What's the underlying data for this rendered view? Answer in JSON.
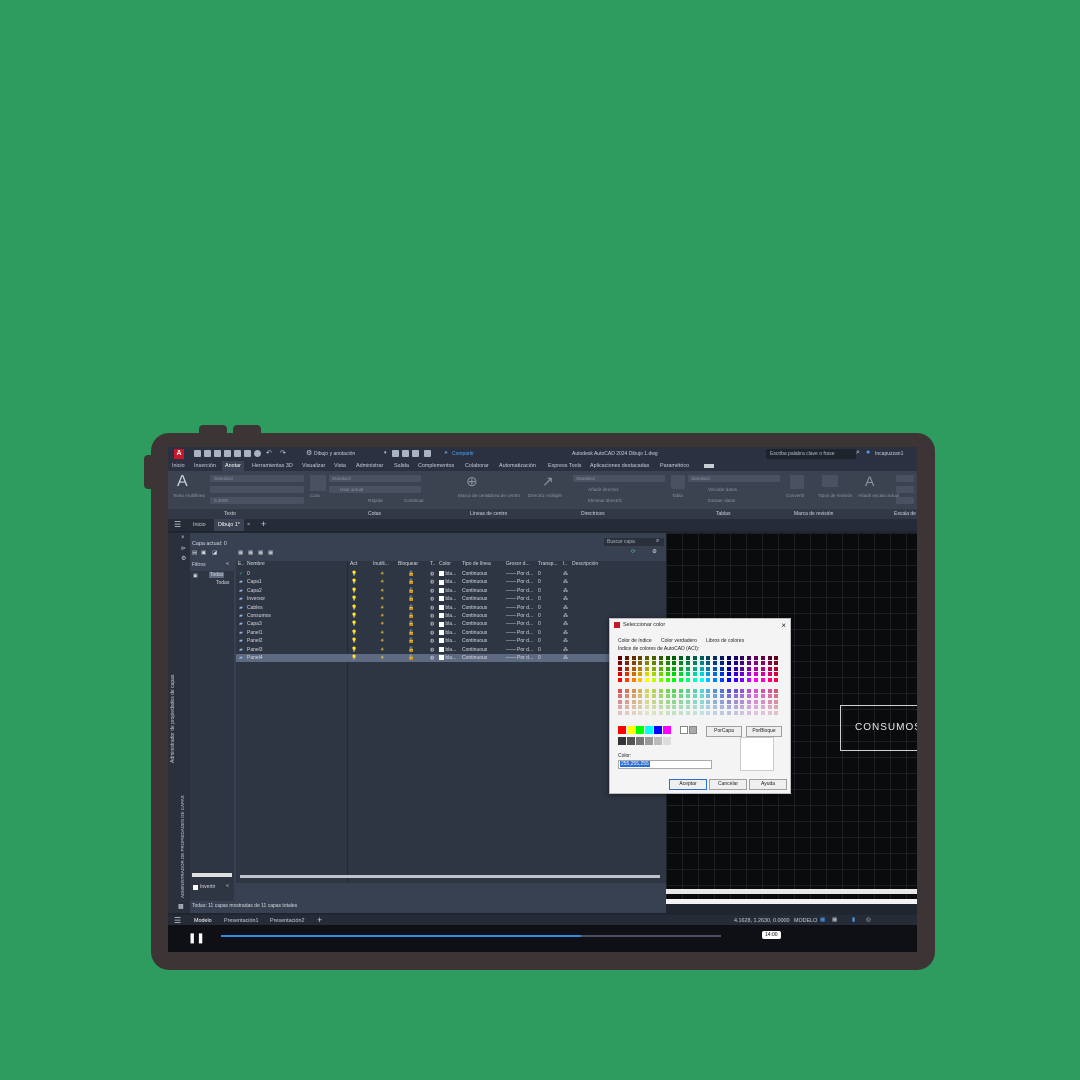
{
  "titlebar": {
    "logo": "A",
    "workspace": "Dibujo y anotación",
    "share": "Compartir",
    "app_title": "Autodesk AutoCAD 2024   Dibujo 1.dwg",
    "search_placeholder": "Escriba palabra clave o frase",
    "user": "Incapuzzan1"
  },
  "menu": [
    "Inicio",
    "Inserción",
    "Anotar",
    "Herramientas 3D",
    "Visualizar",
    "Vista",
    "Administrar",
    "Salida",
    "Complementos",
    "Colaborar",
    "Automatización",
    "Express Tools",
    "Aplicaciones destacadas",
    "Paramétrico"
  ],
  "menu_active_index": 2,
  "ribbon": {
    "panels": [
      "Texto",
      "Cotas",
      "Líneas de centro",
      "Directrices",
      "Tablas",
      "Marca de revisión",
      "Escala de"
    ],
    "text_style": "Standard",
    "text_height": "0.4000",
    "dim_style": "Standard",
    "dim_layer": "Usar actual",
    "mleader_style": "Standard",
    "table_style": "Standard",
    "labels": {
      "texto_multilinea": "Texto multilínea",
      "cota": "Cota",
      "rapida": "Rápida",
      "continuar": "Continuar",
      "marca_centro": "Marca de centro",
      "linea_centro": "Línea de centro",
      "directriz_multiple": "Directriz múltiple",
      "anadir_directriz": "Añadir directriz",
      "eliminar_directriz": "Eliminar directriz",
      "tabla": "Tabla",
      "vincular_datos": "Vincular datos",
      "extraer_datos": "Extraer datos",
      "convertir": "Convertir",
      "tipos_revision": "Tipos de revisión",
      "anadir_escala": "Añadir escala actual"
    }
  },
  "doc_tabs": {
    "inicio": "Inicio",
    "current": "Dibujo 1*"
  },
  "layers_manager": {
    "vertical_title": "Administrador de propiedades de capas",
    "vertical_title_caps": "ADMINISTRADOR DE PROPIEDADES DE CAPAS",
    "current_layer": "Capa actual: 0",
    "search_placeholder": "Buscar capa",
    "filters_label": "Filtros",
    "filter_all": "Todas",
    "filter_used": "Todas",
    "invert_label": "Invertir",
    "status_text": "Todas: 11 capas mostradas de 11 capas totales",
    "columns": [
      "E..",
      "Nombre",
      "Act",
      "Inutili...",
      "Bloquear",
      "T..",
      "Color",
      "Tipo de línea",
      "Grosor d...",
      "Transp...",
      "I..",
      "Descripción"
    ],
    "rows": [
      {
        "name": "0",
        "color": "bla...",
        "linetype": "Continuous",
        "weight": "Por d...",
        "transp": "0",
        "current": true
      },
      {
        "name": "Capa1",
        "color": "bla...",
        "linetype": "Continuous",
        "weight": "Por d...",
        "transp": "0"
      },
      {
        "name": "Capa2",
        "color": "bla...",
        "linetype": "Continuous",
        "weight": "Por d...",
        "transp": "0"
      },
      {
        "name": "Inversor",
        "color": "bla...",
        "linetype": "Continuous",
        "weight": "Por d...",
        "transp": "0"
      },
      {
        "name": "Cables",
        "color": "bla...",
        "linetype": "Continuous",
        "weight": "Por d...",
        "transp": "0"
      },
      {
        "name": "Consumos",
        "color": "bla...",
        "linetype": "Continuous",
        "weight": "Por d...",
        "transp": "0"
      },
      {
        "name": "Capa3",
        "color": "bla...",
        "linetype": "Continuous",
        "weight": "Por d...",
        "transp": "0"
      },
      {
        "name": "Panel1",
        "color": "bla...",
        "linetype": "Continuous",
        "weight": "Por d...",
        "transp": "0"
      },
      {
        "name": "Panel2",
        "color": "bla...",
        "linetype": "Continuous",
        "weight": "Por d...",
        "transp": "0"
      },
      {
        "name": "Panel3",
        "color": "bla...",
        "linetype": "Continuous",
        "weight": "Por d...",
        "transp": "0"
      },
      {
        "name": "Panel4",
        "color": "bla...",
        "linetype": "Continuous",
        "weight": "Por d...",
        "transp": "0",
        "selected": true
      }
    ]
  },
  "canvas": {
    "block_label": "CONSUMOS"
  },
  "color_dialog": {
    "title": "Seleccionar color",
    "tabs": [
      "Color de índice",
      "Color verdadero",
      "Libros de colores"
    ],
    "palette_title": "Índice de colores de AutoCAD (ACI):",
    "bylayer": "PorCapa",
    "byblock": "PorBloque",
    "color_label": "Color:",
    "color_value": "255,255,255",
    "ok": "Aceptar",
    "cancel": "Cancelar",
    "help": "Ayuda"
  },
  "layout_tabs": [
    "Modelo",
    "Presentación1",
    "Presentación2"
  ],
  "status_bar": {
    "coords": "4.1628, 1.2630, 0.0000",
    "mode": "MODELO"
  },
  "video": {
    "progress": 0.72,
    "time": "14:00"
  }
}
